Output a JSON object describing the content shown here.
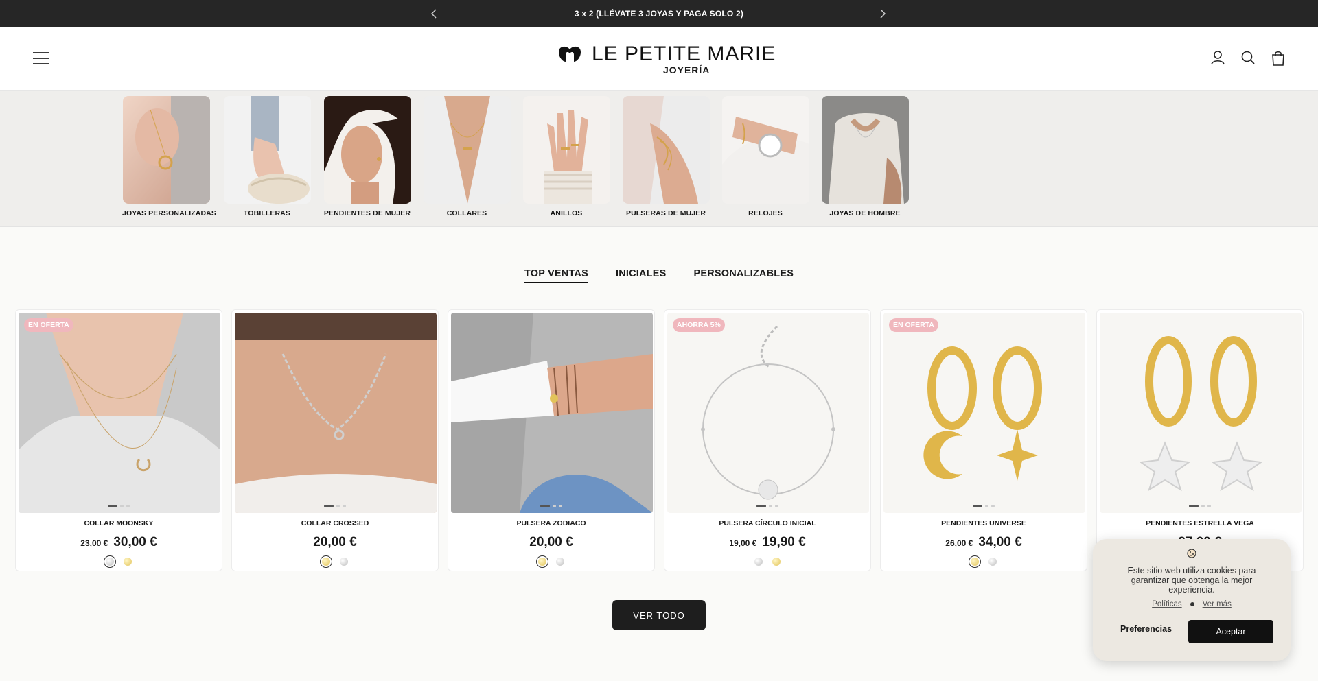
{
  "announcement": {
    "text": "3 x 2 (LLÉVATE 3 JOYAS Y PAGA SOLO 2)"
  },
  "header": {
    "brand_name": "LE PETITE MARIE",
    "brand_sub": "JOYERÍA"
  },
  "categories": [
    {
      "label": "JOYAS PERSONALIZADAS",
      "icon": "necklace-photo"
    },
    {
      "label": "TOBILLERAS",
      "icon": "anklet-photo"
    },
    {
      "label": "PENDIENTES DE MUJER",
      "icon": "earrings-photo"
    },
    {
      "label": "COLLARES",
      "icon": "necklace-photo"
    },
    {
      "label": "ANILLOS",
      "icon": "rings-photo"
    },
    {
      "label": "PULSERAS DE MUJER",
      "icon": "bracelet-photo"
    },
    {
      "label": "RELOJES",
      "icon": "watch-photo"
    },
    {
      "label": "JOYAS DE HOMBRE",
      "icon": "men-photo"
    }
  ],
  "tabs": [
    "TOP VENTAS",
    "INICIALES",
    "PERSONALIZABLES"
  ],
  "products": [
    {
      "name": "COLLAR MOONSKY",
      "badge": "EN OFERTA",
      "sale_price": "23,00 €",
      "old_price": "30,00 €"
    },
    {
      "name": "COLLAR CROSSED",
      "price": "20,00 €"
    },
    {
      "name": "PULSERA ZODIACO",
      "price": "20,00 €"
    },
    {
      "name": "PULSERA CÍRCULO INICIAL",
      "badge": "AHORRA 5%",
      "sale_price": "19,00 €",
      "old_price": "19,90 €"
    },
    {
      "name": "PENDIENTES UNIVERSE",
      "badge": "EN OFERTA",
      "sale_price": "26,00 €",
      "old_price": "34,00 €"
    },
    {
      "name": "PENDIENTES ESTRELLA VEGA",
      "price": "27,00 €"
    }
  ],
  "view_all": "VER TODO",
  "cookie": {
    "text": "Este sitio web utiliza cookies para garantizar que obtenga la mejor experiencia.",
    "link_policies": "Políticas",
    "link_more": "Ver más",
    "preferences": "Preferencias",
    "accept": "Aceptar"
  },
  "colors": {
    "announce_bg": "#262626",
    "badge_pink": "#f0b7bd",
    "button_dark": "#1e1e1e"
  }
}
